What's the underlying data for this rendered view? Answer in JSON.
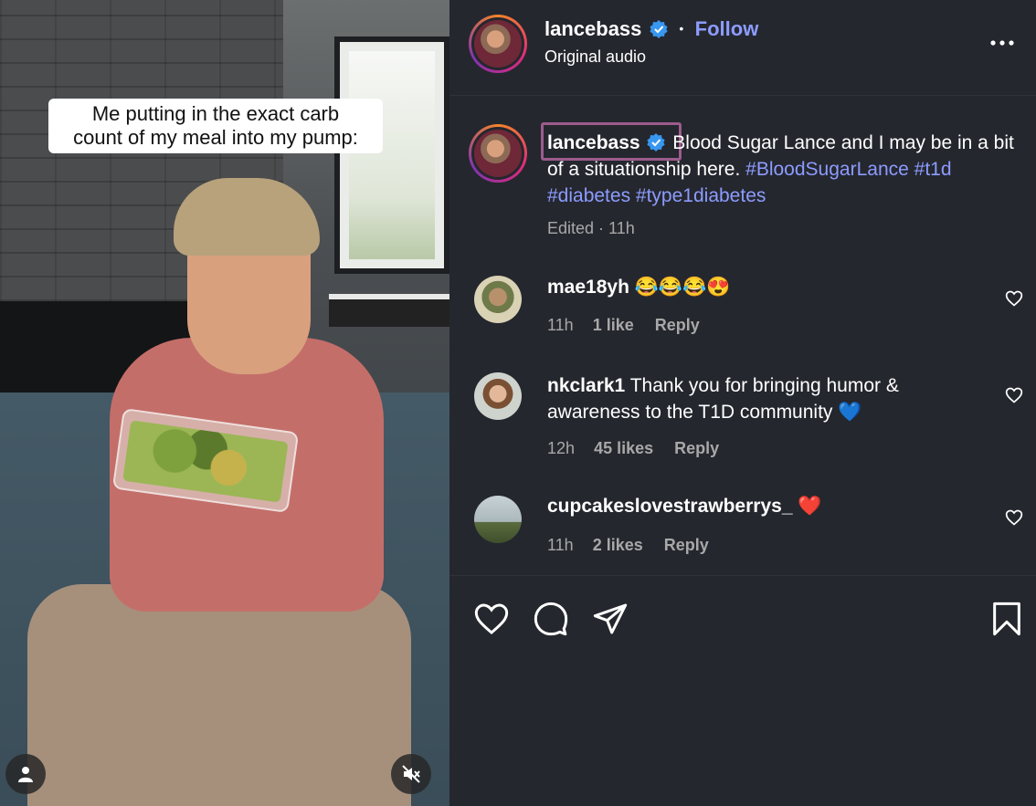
{
  "video": {
    "caption_line1": "Me putting in the exact carb",
    "caption_line2": "count of my meal into my pump:"
  },
  "header": {
    "username": "lancebass",
    "separator": "•",
    "follow_label": "Follow",
    "audio_label": "Original audio"
  },
  "post": {
    "username": "lancebass",
    "text": "Blood Sugar Lance and I may be in a bit of a situationship here.",
    "hashtags": [
      "#BloodSugarLance",
      "#t1d",
      "#diabetes",
      "#type1diabetes"
    ],
    "meta": "Edited · 11h"
  },
  "comments": [
    {
      "username": "mae18yh",
      "text": "😂😂😂😍",
      "time": "11h",
      "likes": "1 like",
      "reply": "Reply"
    },
    {
      "username": "nkclark1",
      "text_line1": "Thank you for bringing humor &",
      "text_line2": "awareness to the T1D community 💙",
      "time": "12h",
      "likes": "45 likes",
      "reply": "Reply"
    },
    {
      "username": "cupcakeslovestrawberrys_",
      "text": "❤️",
      "time": "11h",
      "likes": "2 likes",
      "reply": "Reply"
    }
  ],
  "colors": {
    "accent": "#8c9cff",
    "verified": "#3897f0",
    "panel_bg": "#25272e"
  }
}
